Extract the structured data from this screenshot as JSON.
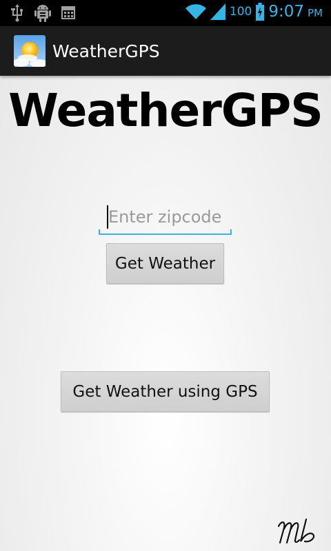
{
  "status_bar": {
    "battery_level": "100",
    "time": "9:07",
    "ampm": "PM",
    "accent_color": "#33b5e5",
    "icons": [
      "usb-icon",
      "android-debug-icon",
      "calendar-icon",
      "wifi-icon",
      "signal-icon",
      "battery-charging-icon"
    ]
  },
  "action_bar": {
    "app_title": "WeatherGPS",
    "app_icon": "weather-sun-cloud-icon"
  },
  "main": {
    "heading": "WeatherGPS",
    "zipcode_input": {
      "value": "",
      "placeholder": "Enter zipcode"
    },
    "get_weather_label": "Get Weather",
    "get_weather_gps_label": "Get Weather using GPS"
  }
}
